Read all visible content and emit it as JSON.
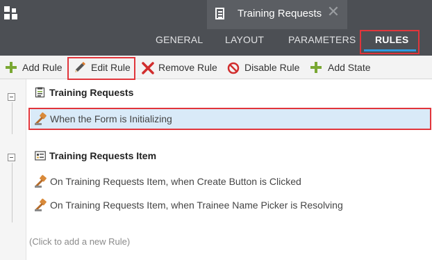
{
  "header": {
    "document_tab": {
      "title": "Training Requests",
      "icon": "form-document-icon",
      "close_icon": "close-icon"
    },
    "app_icon": "app-grid-icon",
    "tabs": [
      {
        "label": "GENERAL"
      },
      {
        "label": "LAYOUT"
      },
      {
        "label": "PARAMETERS"
      },
      {
        "label": "RULES",
        "active": true
      }
    ]
  },
  "toolbar": {
    "add_rule": "Add Rule",
    "edit_rule": "Edit Rule",
    "remove_rule": "Remove Rule",
    "disable_rule": "Disable Rule",
    "add_state": "Add State"
  },
  "groups": [
    {
      "title": "Training Requests",
      "icon": "form-icon",
      "rules": [
        {
          "label": "When the Form is Initializing",
          "selected": true
        }
      ]
    },
    {
      "title": "Training Requests Item",
      "icon": "view-icon",
      "rules": [
        {
          "label": "On Training Requests Item, when Create Button is Clicked"
        },
        {
          "label": "On Training Requests Item, when Trainee Name Picker is Resolving"
        }
      ]
    }
  ],
  "add_rule_hint": "(Click to add a new Rule)",
  "colors": {
    "header_bg": "#4c4f54",
    "active_tab_underline": "#2e9be0",
    "highlight_border": "#e1353b",
    "selected_row": "#d9eaf8",
    "add_icon": "#7aa833",
    "remove_icon": "#d12d2d"
  }
}
